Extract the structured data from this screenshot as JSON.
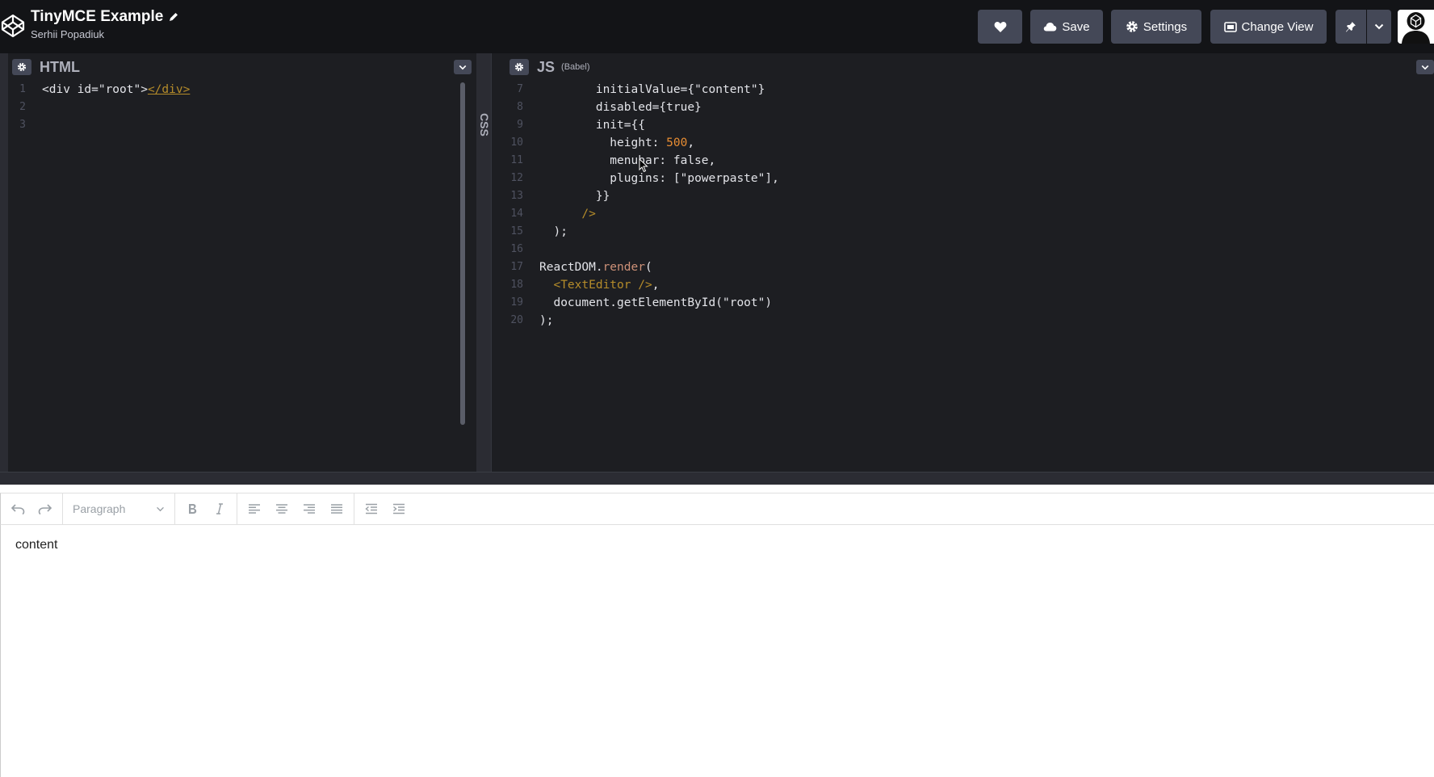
{
  "header": {
    "title": "TinyMCE Example",
    "author": "Serhii Popadiuk",
    "buttons": {
      "save": "Save",
      "settings": "Settings",
      "change_view": "Change View"
    }
  },
  "html_pane": {
    "title": "HTML",
    "lines": [
      {
        "n": "1",
        "code": "<div id=\"root\"></div>"
      },
      {
        "n": "2",
        "code": ""
      },
      {
        "n": "3",
        "code": ""
      }
    ]
  },
  "css_pane": {
    "title": "CSS"
  },
  "js_pane": {
    "title": "JS",
    "subtitle": "(Babel)",
    "lines": [
      {
        "n": "7",
        "code": "        initialValue={\"content\"}"
      },
      {
        "n": "8",
        "code": "        disabled={true}"
      },
      {
        "n": "9",
        "code": "        init={{"
      },
      {
        "n": "10",
        "code": "          height: 500,"
      },
      {
        "n": "11",
        "code": "          menubar: false,"
      },
      {
        "n": "12",
        "code": "          plugins: [\"powerpaste\"],"
      },
      {
        "n": "13",
        "code": "        }}"
      },
      {
        "n": "14",
        "code": "      />"
      },
      {
        "n": "15",
        "code": "  );"
      },
      {
        "n": "16",
        "code": ""
      },
      {
        "n": "17",
        "code": "ReactDOM.render("
      },
      {
        "n": "18",
        "code": "  <TextEditor />,"
      },
      {
        "n": "19",
        "code": "  document.getElementById(\"root\")"
      },
      {
        "n": "20",
        "code": ");"
      }
    ]
  },
  "preview": {
    "block_format": "Paragraph",
    "content": "content"
  },
  "colors": {
    "header_bg": "#131417",
    "button_bg": "#444857",
    "editor_bg": "#1d1e22",
    "number": "#e88d33",
    "jsx": "#b58c2a"
  }
}
